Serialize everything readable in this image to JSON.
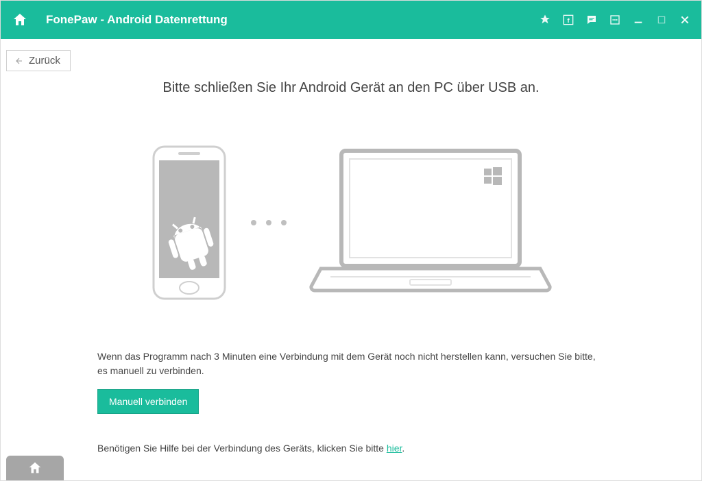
{
  "titlebar": {
    "title": "FonePaw - Android Datenrettung"
  },
  "back": {
    "label": "Zurück"
  },
  "main": {
    "headline": "Bitte schließen Sie Ihr Android Gerät an den PC über USB an.",
    "instruction": "Wenn das Programm nach 3 Minuten eine Verbindung mit dem Gerät noch nicht herstellen kann, versuchen Sie bitte, es manuell zu verbinden.",
    "manual_button": "Manuell verbinden",
    "help_prefix": "Benötigen Sie Hilfe bei der Verbindung des Geräts, klicken Sie bitte ",
    "help_link": "hier",
    "help_suffix": "."
  }
}
